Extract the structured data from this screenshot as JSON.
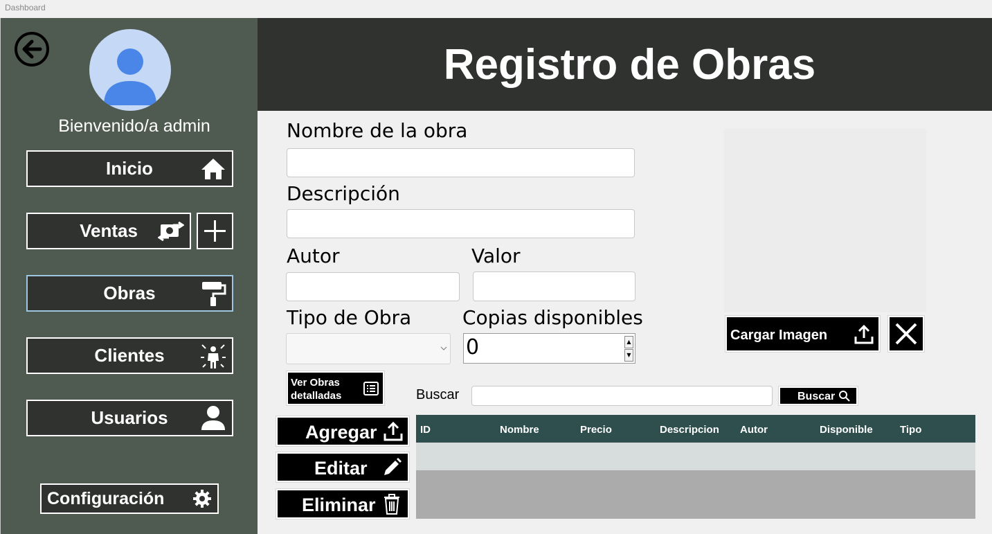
{
  "window": {
    "title": "Dashboard"
  },
  "sidebar": {
    "welcome": "Bienvenido/a admin",
    "items": [
      {
        "label": "Inicio",
        "icon": "home-icon"
      },
      {
        "label": "Ventas",
        "icon": "money-exchange-icon"
      },
      {
        "label": "Obras",
        "icon": "paint-roller-icon",
        "active": true
      },
      {
        "label": "Clientes",
        "icon": "person-rays-icon"
      },
      {
        "label": "Usuarios",
        "icon": "user-icon"
      }
    ],
    "config_label": "Configuración"
  },
  "header": {
    "title": "Registro de Obras"
  },
  "form": {
    "nombre_label": "Nombre de la obra",
    "descripcion_label": "Descripción",
    "autor_label": "Autor",
    "valor_label": "Valor",
    "tipo_label": "Tipo de Obra",
    "copias_label": "Copias disponibles",
    "copias_value": "0"
  },
  "image_panel": {
    "cargar_label": "Cargar Imagen"
  },
  "actions": {
    "ver_obras_line1": "Ver Obras",
    "ver_obras_line2": "detalladas",
    "agregar": "Agregar",
    "editar": "Editar",
    "eliminar": "Eliminar"
  },
  "search": {
    "label": "Buscar",
    "button": "Buscar"
  },
  "table": {
    "columns": [
      "ID",
      "Nombre",
      "Precio",
      "Descripcion",
      "Autor",
      "Disponible",
      "Tipo"
    ]
  },
  "colors": {
    "sidebar": "#4f5a50",
    "header": "#2f322f",
    "table_header": "#2f4f4f",
    "avatar_bg": "#c5d9f7",
    "avatar_fg": "#4a86e8"
  }
}
